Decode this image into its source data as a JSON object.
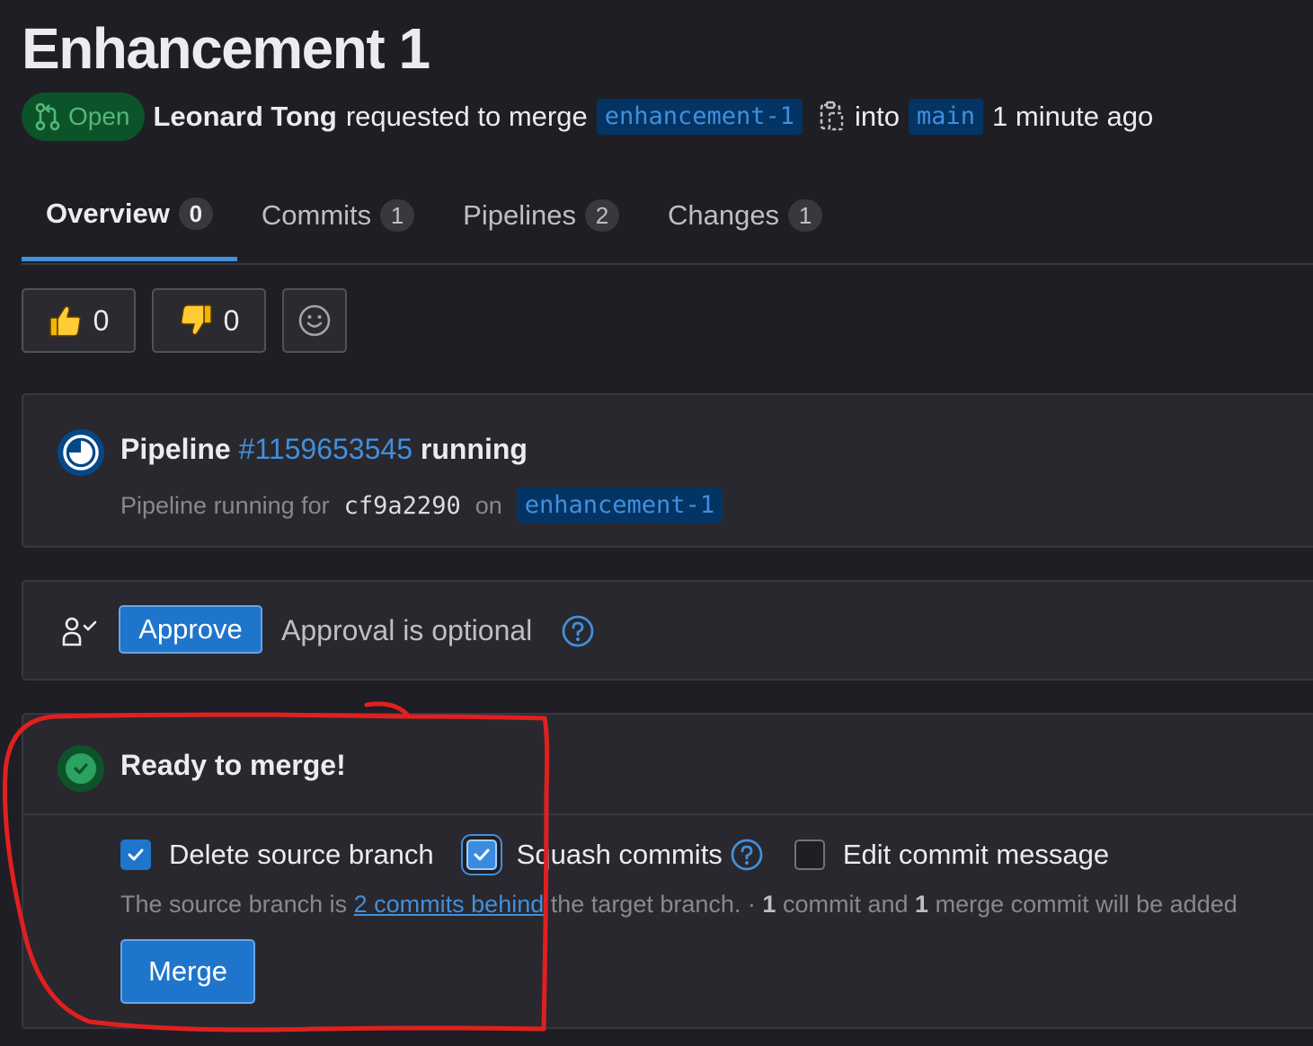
{
  "title": "Enhancement 1",
  "meta": {
    "status": "Open",
    "author": "Leonard Tong",
    "action": "requested to merge",
    "source_branch": "enhancement-1",
    "into": "into",
    "target_branch": "main",
    "time": "1 minute ago"
  },
  "tabs": [
    {
      "label": "Overview",
      "count": "0"
    },
    {
      "label": "Commits",
      "count": "1"
    },
    {
      "label": "Pipelines",
      "count": "2"
    },
    {
      "label": "Changes",
      "count": "1"
    }
  ],
  "reactions": {
    "thumbs_up": "0",
    "thumbs_down": "0"
  },
  "pipeline": {
    "prefix": "Pipeline",
    "id": "#1159653545",
    "status": "running",
    "sub_prefix": "Pipeline running for",
    "sha": "cf9a2290",
    "on": "on",
    "branch": "enhancement-1"
  },
  "approval": {
    "button": "Approve",
    "text": "Approval is optional"
  },
  "merge": {
    "title": "Ready to merge!",
    "options": {
      "delete_source": "Delete source branch",
      "squash": "Squash commits",
      "edit_message": "Edit commit message"
    },
    "behind_prefix": "The source branch is",
    "behind_link": "2 commits behind",
    "behind_suffix": "the target branch. ·",
    "commit_count": "1",
    "commit_and": "commit and",
    "merge_commit_count": "1",
    "merge_commit_suffix": "merge commit will be added",
    "button": "Merge"
  },
  "colors": {
    "background": "#1f1e24",
    "accent": "#428fdc",
    "primary_button": "#1f75cb",
    "success": "#2da160",
    "annotation": "#e02020"
  }
}
